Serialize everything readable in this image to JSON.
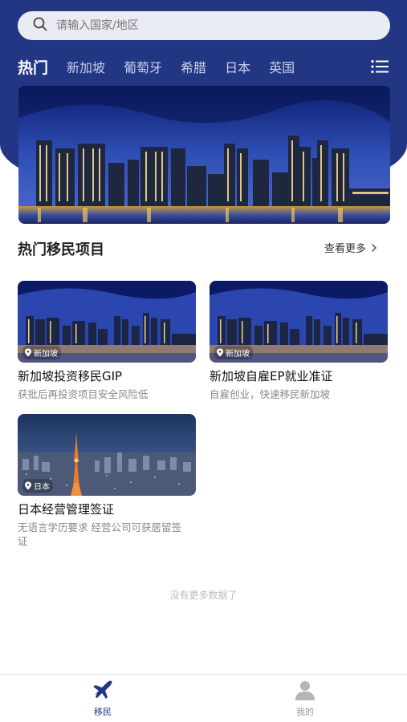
{
  "search": {
    "placeholder": "请输入国家/地区"
  },
  "tabs": [
    {
      "label": "热门",
      "active": true
    },
    {
      "label": "新加坡",
      "active": false
    },
    {
      "label": "葡萄牙",
      "active": false
    },
    {
      "label": "希腊",
      "active": false
    },
    {
      "label": "日本",
      "active": false
    },
    {
      "label": "英国",
      "active": false
    }
  ],
  "section": {
    "title": "热门移民项目",
    "more_label": "查看更多"
  },
  "projects": [
    {
      "location": "新加坡",
      "title": "新加坡投资移民GIP",
      "desc": "获批后再投资项目安全风险低"
    },
    {
      "location": "新加坡",
      "title": "新加坡自雇EP就业准证",
      "desc": "自雇创业，快速移民新加坡"
    },
    {
      "location": "日本",
      "title": "日本经营管理签证",
      "desc": "无语言学历要求 经营公司可获居留签证"
    }
  ],
  "end_text": "没有更多数据了",
  "nav": [
    {
      "label": "移民",
      "icon": "airplane-icon",
      "active": true
    },
    {
      "label": "我的",
      "icon": "user-icon",
      "active": false
    }
  ],
  "colors": {
    "header": "#233684",
    "nav_active": "#233684",
    "nav_inactive": "#999999"
  }
}
